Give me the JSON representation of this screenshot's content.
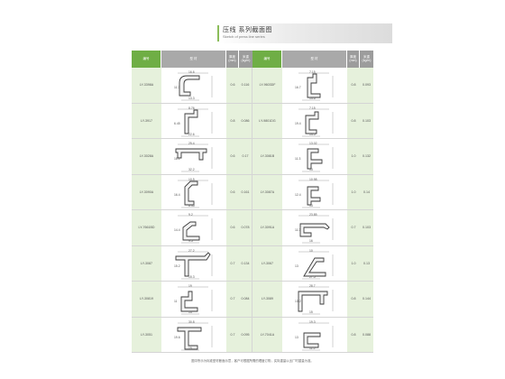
{
  "header": {
    "title": "压线 系列截面图",
    "subtitle": "Sketch of press line series"
  },
  "columns": {
    "code": "编号",
    "shape": "型  材",
    "thickness": "厚度\n(mm)",
    "weight": "米重\n(kg/m)"
  },
  "left_rows": [
    {
      "code": "LY-3398A",
      "thickness": "0.6",
      "weight": "0.116",
      "dims": [
        "16.6",
        "11.3",
        "13.3"
      ]
    },
    {
      "code": "LY-3917",
      "thickness": "0.8",
      "weight": "0.086",
      "dims": [
        "8.76",
        "6.45",
        "22.6"
      ]
    },
    {
      "code": "LY-3028A",
      "thickness": "0.6",
      "weight": "0.17",
      "dims": [
        "25.4",
        "18.1",
        "32.2"
      ]
    },
    {
      "code": "LY-3090A",
      "thickness": "0.6",
      "weight": "0.161",
      "dims": [
        "10.5",
        "16.4",
        "8.35"
      ]
    },
    {
      "code": "LY-7661BD",
      "thickness": "0.6",
      "weight": "0.078",
      "dims": [
        "9.2",
        "14.4",
        "9.5"
      ]
    },
    {
      "code": "LY-3087",
      "thickness": "0.7",
      "weight": "0.134",
      "dims": [
        "27.2",
        "15.2",
        "15.3"
      ]
    },
    {
      "code": "LY-30819",
      "thickness": "0.7",
      "weight": "0.084",
      "dims": [
        "19",
        "11",
        "13"
      ]
    },
    {
      "code": "LY-3051",
      "thickness": "0.7",
      "weight": "0.095",
      "dims": [
        "30.8",
        "19.6",
        "15"
      ]
    }
  ],
  "right_rows": [
    {
      "code": "LY-9603DF",
      "thickness": "0.8",
      "weight": "0.093",
      "dims": [
        "7.15",
        "16.7",
        "14.6"
      ]
    },
    {
      "code": "LY-9801DG",
      "thickness": "0.8",
      "weight": "0.103",
      "dims": [
        "7.15",
        "19.4",
        "14.5"
      ]
    },
    {
      "code": "LY-3081B",
      "thickness": "1.0",
      "weight": "0.132",
      "dims": [
        "13.02",
        "11.3",
        "13"
      ]
    },
    {
      "code": "LY-3087A",
      "thickness": "1.0",
      "weight": "0.14",
      "dims": [
        "10.98",
        "12.4",
        "13"
      ]
    },
    {
      "code": "LY-3091A",
      "thickness": "0.7",
      "weight": "0.103",
      "dims": [
        "23.85",
        "11.3",
        "16"
      ]
    },
    {
      "code": "LY-3067",
      "thickness": "1.0",
      "weight": "0.13",
      "dims": [
        "10",
        "13",
        "27.5"
      ]
    },
    {
      "code": "LY-3089",
      "thickness": "0.8",
      "weight": "0.144",
      "dims": [
        "28.7",
        "13.2",
        "15"
      ]
    },
    {
      "code": "LY-7041A",
      "thickness": "0.8",
      "weight": "0.088",
      "dims": [
        "19.3",
        "13",
        "11.5"
      ]
    }
  ],
  "footnote": "图中所示为标准型材断面示意，客户可根据所需的理度订购，实际重量以出厂时重量为准。"
}
